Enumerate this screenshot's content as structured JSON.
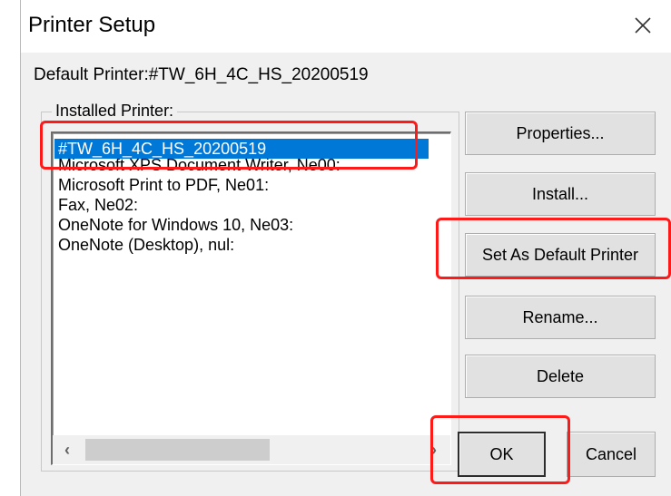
{
  "window": {
    "title": "Printer Setup",
    "close_icon": "close-icon"
  },
  "default_printer": {
    "label": "Default Printer:",
    "value": "#TW_6H_4C_HS_20200519"
  },
  "installed": {
    "group_label": "Installed Printer:",
    "items": [
      {
        "label": "#TW_6H_4C_HS_20200519",
        "selected": true
      },
      {
        "label": "Microsoft XPS Document Writer, Ne00:",
        "selected": false
      },
      {
        "label": "Microsoft Print to PDF, Ne01:",
        "selected": false
      },
      {
        "label": "Fax, Ne02:",
        "selected": false
      },
      {
        "label": "OneNote for Windows 10, Ne03:",
        "selected": false
      },
      {
        "label": "OneNote (Desktop), nul:",
        "selected": false
      }
    ]
  },
  "buttons": {
    "properties": "Properties...",
    "install": "Install...",
    "set_default": "Set As Default Printer",
    "rename": "Rename...",
    "delete": "Delete",
    "ok": "OK",
    "cancel": "Cancel"
  },
  "colors": {
    "selection": "#0078d7",
    "highlight_annotation": "#ff1a1a",
    "dialog_bg": "#f0f0f0"
  }
}
